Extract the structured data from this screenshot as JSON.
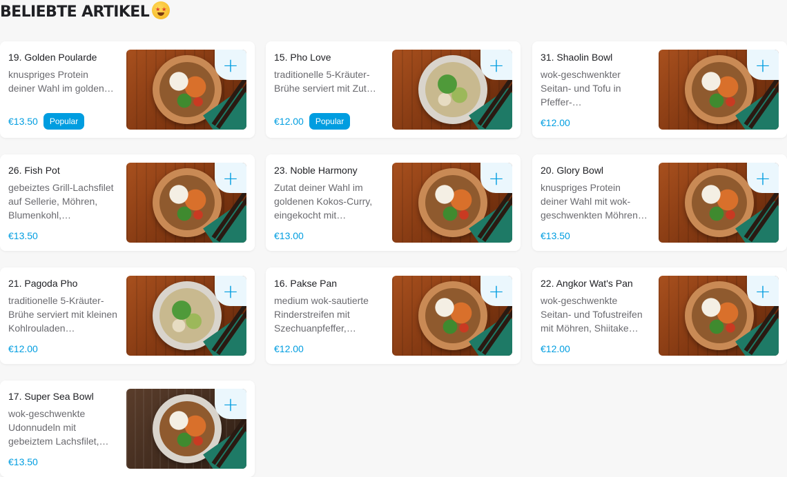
{
  "section": {
    "title": "BELIEBTE ARTIKEL",
    "emoji": "star-struck-emoji"
  },
  "add_label": "+",
  "colors": {
    "accent": "#009de0",
    "card_bg": "#ffffff",
    "page_bg": "#f7f7f7"
  },
  "items": [
    {
      "name": "19. Golden Poularde",
      "description": "knuspriges Protein deiner Wahl im golden…",
      "price": "€13.50",
      "badge": "Popular"
    },
    {
      "name": "15. Pho Love",
      "description": "traditionelle 5-Kräuter-Brühe serviert mit Zut…",
      "price": "€12.00",
      "badge": "Popular"
    },
    {
      "name": "31. Shaolin Bowl",
      "description": "wok-geschwenkter Seitan- und Tofu in Pfeffer-…",
      "price": "€12.00"
    },
    {
      "name": "26. Fish Pot",
      "description": "gebeiztes Grill-Lachsfilet auf Sellerie, Möhren, Blumenkohl,…",
      "price": "€13.50"
    },
    {
      "name": "23. Noble Harmony",
      "description": "Zutat deiner Wahl im goldenen Kokos-Curry, eingekocht mit…",
      "price": "€13.00"
    },
    {
      "name": "20. Glory Bowl",
      "description": "knuspriges Protein deiner Wahl mit wok-geschwenkten Möhren…",
      "price": "€13.50"
    },
    {
      "name": "21. Pagoda Pho",
      "description": "traditionelle 5-Kräuter-Brühe serviert mit kleinen Kohlrouladen…",
      "price": "€12.00"
    },
    {
      "name": "16. Pakse Pan",
      "description": "medium wok-sautierte Rinderstreifen mit Szechuanpfeffer,…",
      "price": "€12.00"
    },
    {
      "name": "22. Angkor Wat's Pan",
      "description": "wok-geschwenkte Seitan- und Tofustreifen mit Möhren, Shiitake…",
      "price": "€12.00"
    },
    {
      "name": "17. Super Sea Bowl",
      "description": "wok-geschwenkte Udonnudeln mit gebeiztem Lachsfilet,…",
      "price": "€13.50"
    }
  ]
}
